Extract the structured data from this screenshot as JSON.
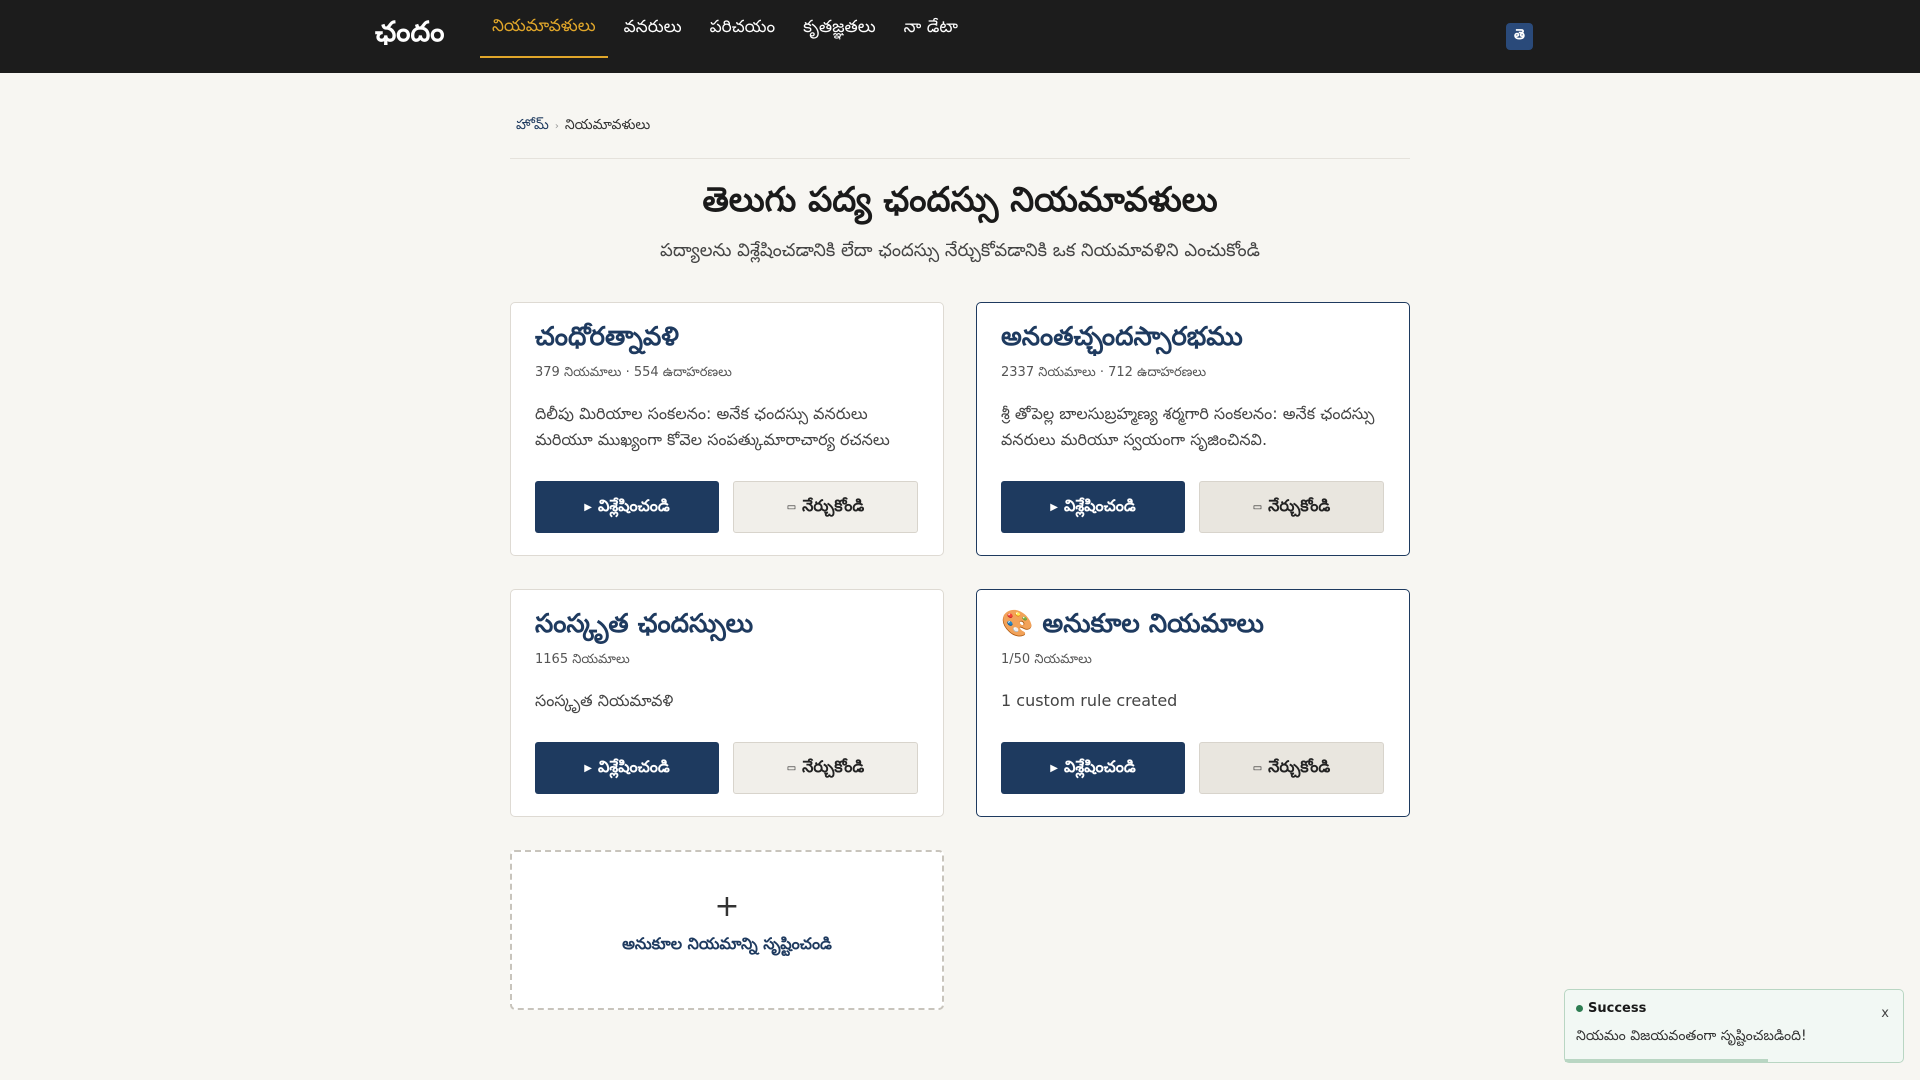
{
  "header": {
    "brand": "ఛందం",
    "nav": [
      {
        "label": "నియమావళులు",
        "active": true
      },
      {
        "label": "వనరులు",
        "active": false
      },
      {
        "label": "పరిచయం",
        "active": false
      },
      {
        "label": "కృతజ్ఞతలు",
        "active": false
      },
      {
        "label": "నా డేటా",
        "active": false
      }
    ],
    "lang_button": "తె"
  },
  "breadcrumb": {
    "home": "హోమ్",
    "separator": "›",
    "current": "నియమావళులు"
  },
  "page": {
    "title": "తెలుగు పద్య ఛందస్సు నియమావళులు",
    "subtitle": "పద్యాలను విశ్లేషించడానికి లేదా ఛందస్సు నేర్చుకోవడానికి ఒక నియమావళిని ఎంచుకోండి"
  },
  "cards": [
    {
      "title": "చంధోరత్నావళి",
      "meta": "379 నియమాలు · 554 ఉదాహరణలు",
      "desc": "దిలీపు మిరియాల సంకలనం: అనేక ఛందస్సు వనరులు మరియూ ముఖ్యంగా కోవెల సంపత్కుమారాచార్య రచనలు",
      "analyze": "విశ్లేషించండి",
      "learn": "నేర్చుకోండి"
    },
    {
      "title": "అనంతచ్ఛందస్సారభము",
      "meta": "2337 నియమాలు · 712 ఉదాహరణలు",
      "desc": "శ్రీ తోపెల్ల బాలసుబ్రహ్మణ్య శర్మగారి సంకలనం: అనేక ఛందస్సు వనరులు మరియూ స్వయంగా సృజించినవి.",
      "analyze": "విశ్లేషించండి",
      "learn": "నేర్చుకోండి"
    },
    {
      "title": "సంస్కృత ఛందస్సులు",
      "meta": "1165 నియమాలు",
      "desc": "సంస్కృత నియమావళి",
      "analyze": "విశ్లేషించండి",
      "learn": "నేర్చుకోండి"
    },
    {
      "title": "🎨 అనుకూల నియమాలు",
      "meta": "1/50 నియమాలు",
      "desc": "1 custom rule created",
      "analyze": "విశ్లేషించండి",
      "learn": "నేర్చుకోండి"
    }
  ],
  "icons": {
    "analyze": "play-icon",
    "learn": "book-icon"
  },
  "add_card": {
    "plus": "+",
    "label": "అనుకూల నియమాన్ని సృష్టించండి"
  },
  "toast": {
    "title": "Success",
    "close": "x",
    "message": "నియమం విజయవంతంగా సృష్టించబడింది!",
    "progress": 0.6
  },
  "colors": {
    "accent": "#e0a62a",
    "primary": "#1e3a5f",
    "header_bg": "#1c1c1c",
    "success": "#2e7d52"
  }
}
